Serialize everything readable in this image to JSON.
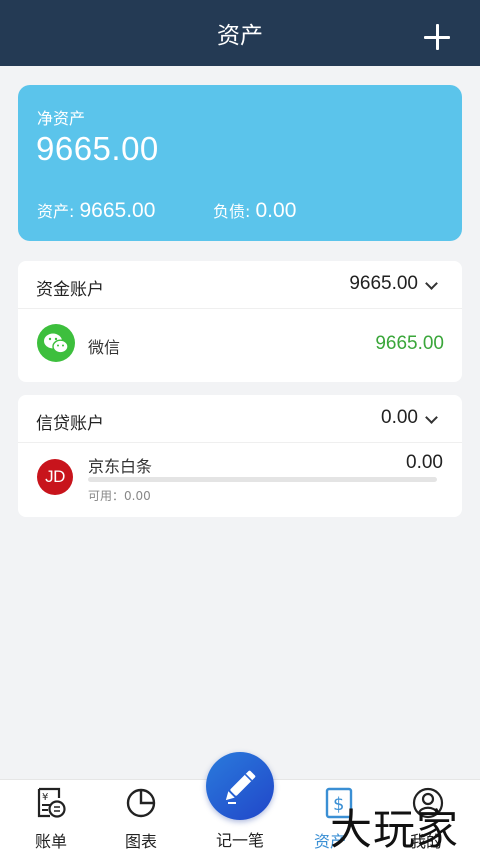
{
  "header": {
    "title": "资产"
  },
  "net_assets": {
    "label": "净资产",
    "value": "9665.00",
    "assets_label": "资产:",
    "assets_value": "9665.00",
    "debt_label": "负债:",
    "debt_value": "0.00"
  },
  "fund_accounts": {
    "title": "资金账户",
    "total": "9665.00",
    "items": [
      {
        "name": "微信",
        "amount": "9665.00",
        "icon": "wechat-icon",
        "amount_color": "#3aa63a"
      }
    ]
  },
  "credit_accounts": {
    "title": "信贷账户",
    "total": "0.00",
    "items": [
      {
        "name": "京东白条",
        "amount": "0.00",
        "icon_text": "JD",
        "available_label": "可用：0.00",
        "usage_fraction": 0
      }
    ]
  },
  "tabbar": {
    "tabs": [
      {
        "label": "账单",
        "icon": "bill-icon"
      },
      {
        "label": "图表",
        "icon": "pie-chart-icon"
      },
      {
        "label": "记一笔",
        "icon": "pencil-icon"
      },
      {
        "label": "资产",
        "icon": "asset-icon",
        "active": true
      },
      {
        "label": "我的",
        "icon": "user-icon"
      }
    ]
  },
  "watermark": "大玩家",
  "colors": {
    "header": "#243a54",
    "card": "#5bc4eb",
    "accent": "#3a8fd4",
    "positive": "#3aa63a",
    "jd": "#c8141c"
  }
}
